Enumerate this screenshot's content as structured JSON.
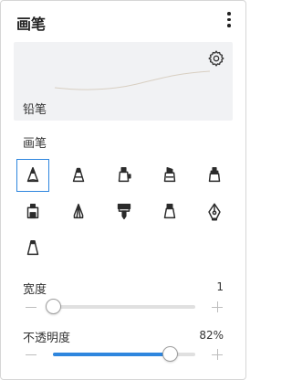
{
  "header": {
    "title": "画笔",
    "more_icon": "more-vertical-icon"
  },
  "preview": {
    "label": "铅笔",
    "settings_icon": "gear-icon"
  },
  "brushes": {
    "section_label": "画笔",
    "items": [
      {
        "icon": "pencil-brush-icon",
        "selected": true
      },
      {
        "icon": "pen-tip-brush-icon",
        "selected": false
      },
      {
        "icon": "marker-brush-icon",
        "selected": false
      },
      {
        "icon": "chisel-marker-brush-icon",
        "selected": false
      },
      {
        "icon": "highlighter-brush-icon",
        "selected": false
      },
      {
        "icon": "stamp-brush-icon",
        "selected": false
      },
      {
        "icon": "crayon-brush-icon",
        "selected": false
      },
      {
        "icon": "paint-brush-icon",
        "selected": false
      },
      {
        "icon": "airbrush-icon",
        "selected": false
      },
      {
        "icon": "fountain-pen-icon",
        "selected": false
      },
      {
        "icon": "ink-brush-icon",
        "selected": false
      }
    ]
  },
  "width": {
    "label": "宽度",
    "value": "1",
    "level": 0.0
  },
  "opacity": {
    "label": "不透明度",
    "value": "82%",
    "level": 0.82
  },
  "colors": {
    "accent": "#2e86de",
    "icon": "#2b2b2b",
    "track": "#e0e0e0",
    "preview_bg": "#f1f2f4"
  }
}
